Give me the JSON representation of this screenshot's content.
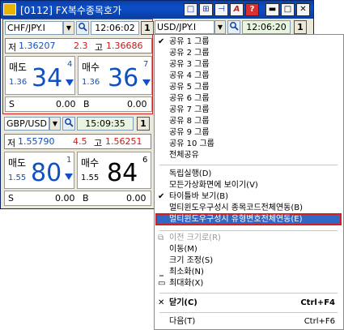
{
  "window": {
    "title": "[0112] FX복수종목호가"
  },
  "title_buttons": [
    "□",
    "⊞",
    "⊣",
    "A",
    "?",
    "▬",
    "□",
    "✕"
  ],
  "pane1": {
    "pair": "CHF/JPY.I",
    "time": "12:06:02",
    "one": "1",
    "low_label": "저",
    "low_value": "1.36207",
    "spread": "2.3",
    "high_label": "고",
    "high_value": "1.36686",
    "sell_label": "매도",
    "sell_small": "1.36",
    "sell_big": "34",
    "sell_sup": "4",
    "buy_label": "매수",
    "buy_small": "1.36",
    "buy_big": "36",
    "buy_sup": "7",
    "s_label": "S",
    "s_value": "0.00",
    "b_label": "B",
    "b_value": "0.00"
  },
  "pane2": {
    "pair": "USD/JPY.I",
    "time": "12:06:20",
    "one": "1"
  },
  "pane3": {
    "pair": "GBP/USD",
    "time": "15:09:35",
    "one": "1",
    "low_label": "저",
    "low_value": "1.55790",
    "spread": "4.5",
    "high_label": "고",
    "high_value": "1.56251",
    "sell_label": "매도",
    "sell_small": "1.55",
    "sell_big": "80",
    "sell_sup": "1",
    "buy_label": "매수",
    "buy_small": "1.55",
    "buy_big": "84",
    "buy_sup": "6",
    "s_label": "S",
    "s_value": "0.00",
    "b_label": "B",
    "b_value": "0.00"
  },
  "menu": {
    "groups": [
      "공유 1 그룹",
      "공유 2 그룹",
      "공유 3 그룹",
      "공유 4 그룹",
      "공유 5 그룹",
      "공유 6 그룹",
      "공유 7 그룹",
      "공유 8 그룹",
      "공유 9 그룹",
      "공유 10 그룹",
      "전체공유"
    ],
    "independent": "독립실행(D)",
    "show_all_screens": "모든가상화면에 보이기(V)",
    "titlebar_view": "타이틀바 보기(B)",
    "multi_code_link": "멀티윈도우구성시 종목코드전체연동(B)",
    "multi_type_link": "멀티윈도우구성시 유형변호전체연동(E)",
    "prev_size": "이전 크기로(R)",
    "move": "이동(M)",
    "resize": "크기 조정(S)",
    "minimize": "최소화(N)",
    "maximize": "최대화(X)",
    "close": "닫기(C)",
    "close_shortcut": "Ctrl+F4",
    "next": "다음(T)",
    "next_shortcut": "Ctrl+F6"
  },
  "colors": {
    "red": "#d01818",
    "blue": "#1050c0",
    "highlight": "#3167c5",
    "outline": "#d02020"
  }
}
